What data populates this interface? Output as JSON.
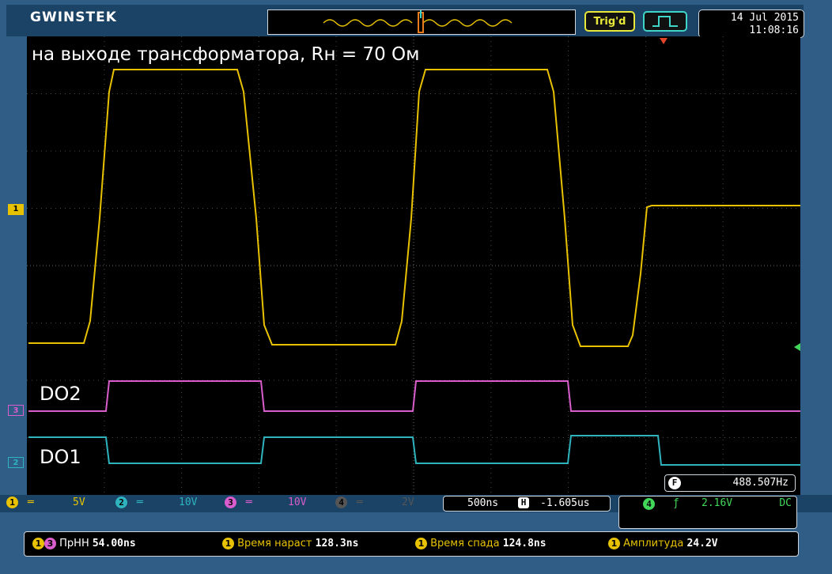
{
  "brand": "GWINSTEK",
  "status": {
    "trigger_state": "Trig'd",
    "date": "14 Jul 2015",
    "time": "11:08:16"
  },
  "title": "на выходе трансформатора, Rн = 70 Ом",
  "channel_labels": {
    "do2": "DO2",
    "do1": "DO1"
  },
  "markers": {
    "ch1": "1",
    "ch3": "3",
    "ch2": "2"
  },
  "frequency": {
    "badge": "F",
    "value": "488.507Hz"
  },
  "channels": [
    {
      "num": "1",
      "scale": "5V",
      "color": "#e8c200"
    },
    {
      "num": "2",
      "scale": "10V",
      "color": "#2fb3bf"
    },
    {
      "num": "3",
      "scale": "10V",
      "color": "#d95dcc"
    },
    {
      "num": "4",
      "scale": "2V",
      "color": "#555555"
    }
  ],
  "timebase": {
    "scale": "500ns",
    "h_badge": "H",
    "offset": "-1.605us"
  },
  "trigger": {
    "source": "4",
    "slope": "ƒ",
    "level": "2.16V",
    "coupling": "DC"
  },
  "measurements": [
    {
      "label": "ПрНН",
      "value": "54.00ns"
    },
    {
      "label": "Время нараст",
      "value": "128.3ns"
    },
    {
      "label": "Время спада",
      "value": "124.8ns"
    },
    {
      "label": "Амплитуда",
      "value": "24.2V"
    }
  ],
  "colors": {
    "ch1": "#e8c200",
    "ch2": "#2fb3bf",
    "ch3": "#d95dcc",
    "trigger": "#41d85a",
    "marker_red": "#e0452a"
  }
}
